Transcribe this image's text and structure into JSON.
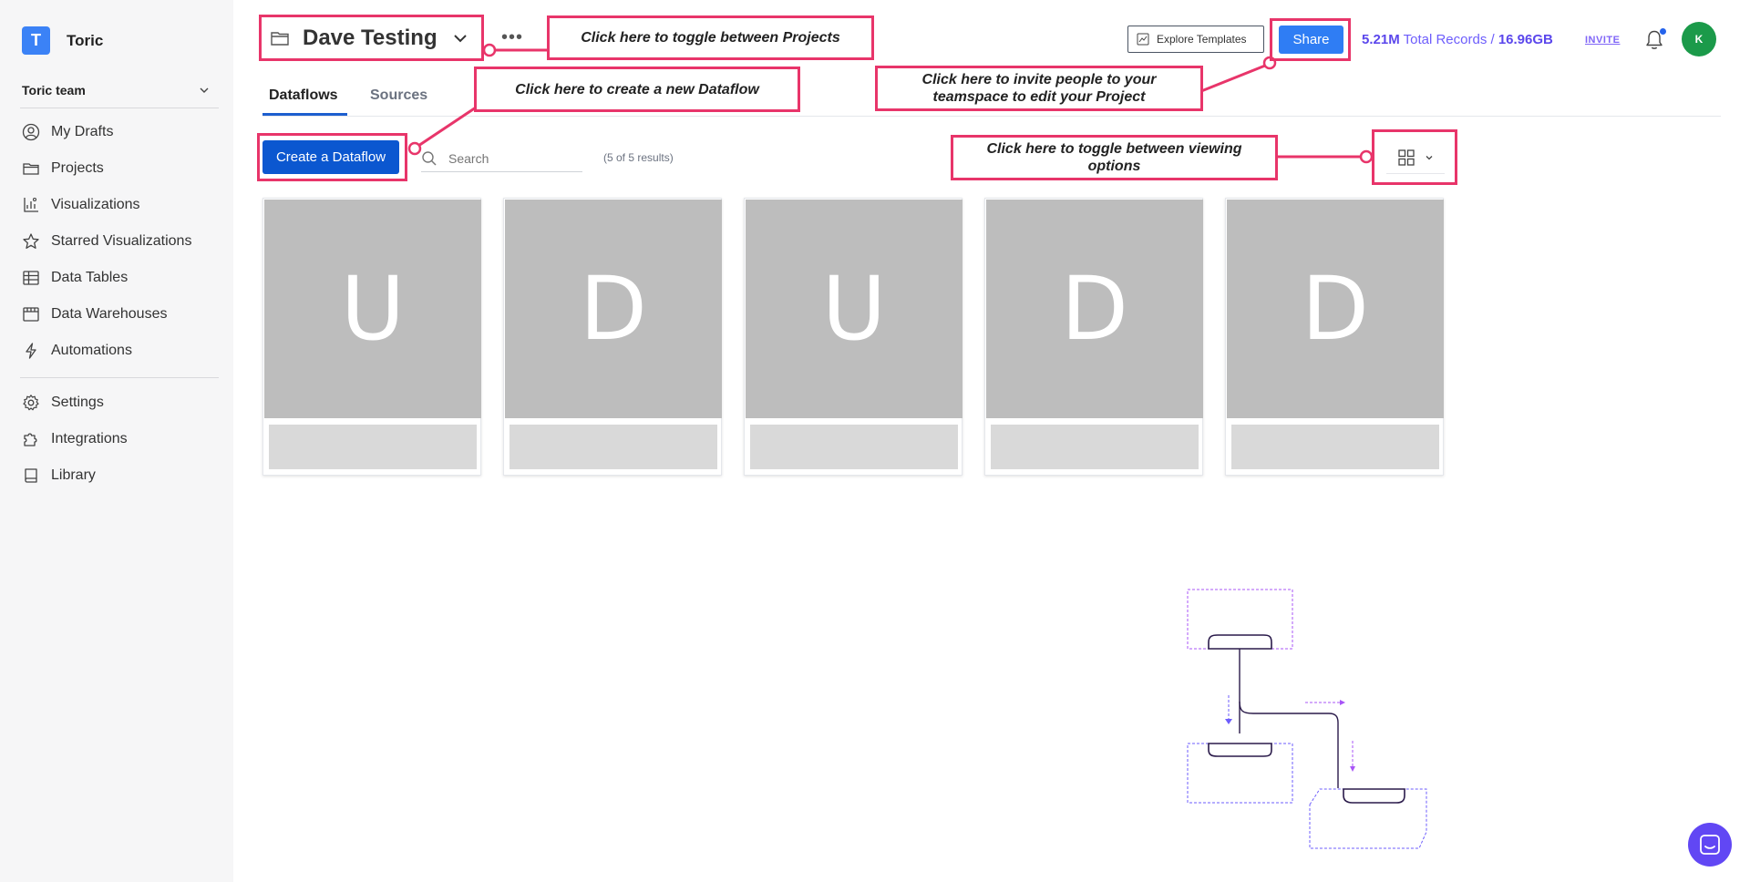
{
  "brand": {
    "logo_letter": "T",
    "name": "Toric",
    "color": "#3b82f6"
  },
  "team": {
    "name": "Toric team"
  },
  "sidebar": {
    "items": [
      {
        "label": "My Drafts",
        "icon": "user-circle-icon"
      },
      {
        "label": "Projects",
        "icon": "folder-icon"
      },
      {
        "label": "Visualizations",
        "icon": "chart-icon"
      },
      {
        "label": "Starred Visualizations",
        "icon": "star-icon"
      },
      {
        "label": "Data Tables",
        "icon": "table-icon"
      },
      {
        "label": "Data Warehouses",
        "icon": "warehouse-icon"
      },
      {
        "label": "Automations",
        "icon": "lightning-icon"
      }
    ],
    "secondary": [
      {
        "label": "Settings",
        "icon": "gear-icon"
      },
      {
        "label": "Integrations",
        "icon": "puzzle-icon"
      },
      {
        "label": "Library",
        "icon": "book-icon"
      }
    ]
  },
  "header": {
    "project_title": "Dave Testing",
    "more": "•••",
    "explore_label": "Explore Templates",
    "share_label": "Share",
    "records_count": "5.21M",
    "records_label": "Total Records /",
    "storage": "16.96GB",
    "invite_label": "INVITE",
    "avatar_initial": "K",
    "accent": "#2f7df4",
    "avatar_color": "#1b9a4a"
  },
  "tabs": [
    {
      "label": "Dataflows",
      "active": true
    },
    {
      "label": "Sources",
      "active": false
    }
  ],
  "toolbar": {
    "create_label": "Create a Dataflow",
    "search_placeholder": "Search",
    "results": "(5 of 5 results)"
  },
  "cards": [
    {
      "letter": "U"
    },
    {
      "letter": "D"
    },
    {
      "letter": "U"
    },
    {
      "letter": "D"
    },
    {
      "letter": "D"
    }
  ],
  "annotations": {
    "toggle_projects": "Click here to toggle between Projects",
    "create_dataflow": "Click here to create a new Dataflow",
    "invite_line1": "Click here to invite people to your",
    "invite_line2": "teamspace to edit your Project",
    "view_line1": "Click here to toggle between viewing",
    "view_line2": "options",
    "color": "#e8356a"
  }
}
